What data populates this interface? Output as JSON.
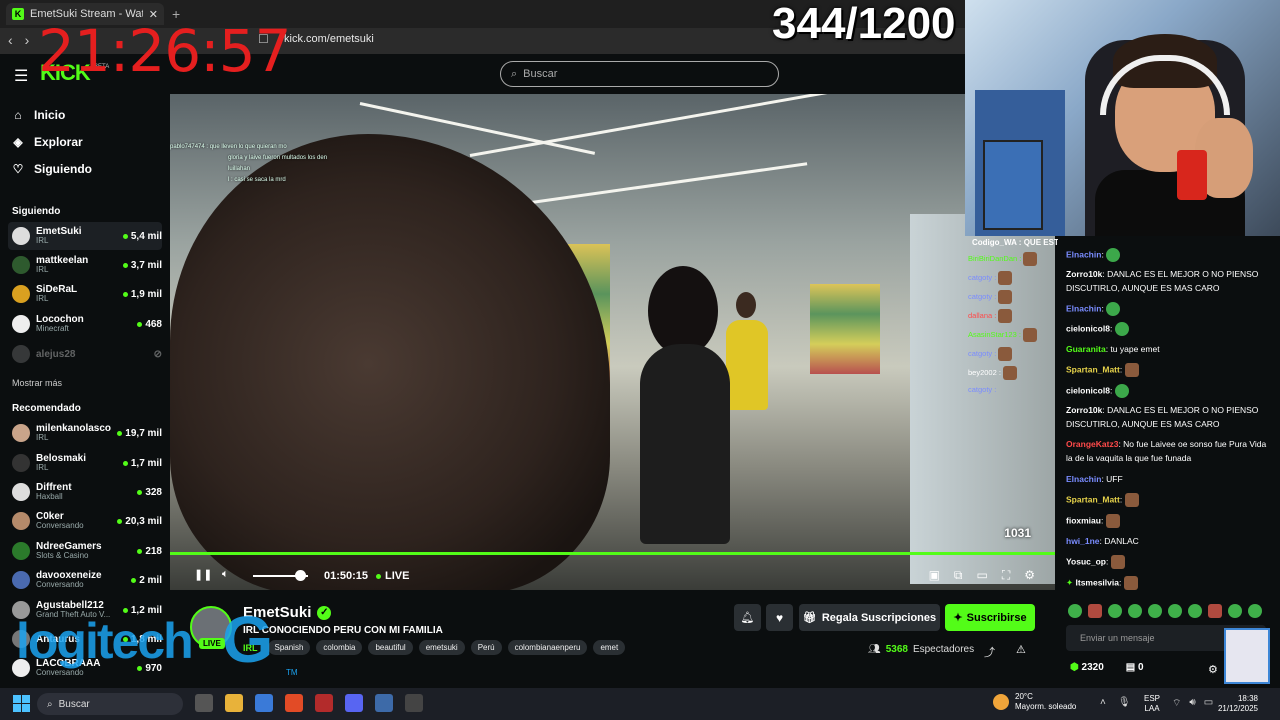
{
  "browser": {
    "tab_title": "EmetSuki Stream - Watch Liv",
    "tab_close": "✕",
    "new_tab": "+",
    "url": "kick.com/emetsuki"
  },
  "overlay": {
    "clock": "21:26:57",
    "counter": "344/1200",
    "logitech": "logitech",
    "logitech_g": "G",
    "logitech_tm": "TM"
  },
  "header": {
    "logo": "KICK",
    "beta": "BETA",
    "search_placeholder": "Buscar"
  },
  "sidebar": {
    "nav": [
      {
        "label": "Inicio",
        "icon": "home-icon"
      },
      {
        "label": "Explorar",
        "icon": "compass-icon"
      },
      {
        "label": "Siguiendo",
        "icon": "heart-icon"
      }
    ],
    "following_title": "Siguiendo",
    "following": [
      {
        "name": "EmetSuki",
        "category": "IRL",
        "viewers": "5,4 mil"
      },
      {
        "name": "mattkeelan",
        "category": "IRL",
        "viewers": "3,7 mil"
      },
      {
        "name": "SiDeRaL",
        "category": "IRL",
        "viewers": "1,9 mil"
      },
      {
        "name": "Locochon",
        "category": "Minecraft",
        "viewers": "468"
      },
      {
        "name": "alejus28",
        "category": "",
        "viewers": ""
      }
    ],
    "show_more": "Mostrar más",
    "recommended_title": "Recomendado",
    "recommended": [
      {
        "name": "milenkanolasco",
        "category": "IRL",
        "viewers": "19,7 mil"
      },
      {
        "name": "Belosmaki",
        "category": "IRL",
        "viewers": "1,7 mil"
      },
      {
        "name": "Diffrent",
        "category": "Haxball",
        "viewers": "328"
      },
      {
        "name": "C0ker",
        "category": "Conversando",
        "viewers": "20,3 mil"
      },
      {
        "name": "NdreeGamers",
        "category": "Slots & Casino",
        "viewers": "218"
      },
      {
        "name": "davooxeneize",
        "category": "Conversando",
        "viewers": "2 mil"
      },
      {
        "name": "Agustabell212",
        "category": "Grand Theft Auto V...",
        "viewers": "1,2 mil"
      },
      {
        "name": "Antaurus",
        "category": "",
        "viewers": "1,8 mil"
      },
      {
        "name": "LACOBRAAA",
        "category": "Conversando",
        "viewers": "970"
      }
    ]
  },
  "video": {
    "overlay_chat": [
      "pablo747474 : que lleven lo que quieran mo",
      "gloria y laive fueron multados los den",
      "luillahan",
      "l : casi se saca la mrd"
    ],
    "time": "01:50:15",
    "live": "LIVE",
    "volume": 0.85,
    "corner_num": "1031"
  },
  "stream": {
    "name": "EmetSuki",
    "live_badge": "LIVE",
    "title": "IRL CONOCIENDO PERU CON MI FAMILIA",
    "category": "IRL",
    "tags": [
      "Spanish",
      "colombia",
      "beautiful",
      "emetsuki",
      "Perú",
      "colombianaenperu",
      "emet"
    ],
    "gift_label": "Regala Suscripciones",
    "subscribe_label": "Suscribirse",
    "viewers_count": "5368",
    "viewers_label": "Espectadores"
  },
  "minichat": [
    {
      "user": "BiriBiriDanDan :",
      "color": "#53fc18"
    },
    {
      "user": "catgoty :",
      "color": "#7a8cff"
    },
    {
      "user": "catgoty :",
      "color": "#7a8cff"
    },
    {
      "user": "dallana :",
      "color": "#ff4a4a"
    },
    {
      "user": "AsasinStar123 :",
      "color": "#53fc18"
    },
    {
      "user": "catgoty :",
      "color": "#7a8cff"
    },
    {
      "user": "bey2002 :",
      "color": "#ffffff"
    },
    {
      "user": "catgoty :",
      "color": "#7a8cff"
    }
  ],
  "chat": {
    "pinned": "Codigo_WA : QUE ESTAS VIENDO SOBRINO",
    "messages": [
      {
        "user": "Elnachin",
        "text": "",
        "color": "#7a8cff",
        "emote": true
      },
      {
        "user": "Zorro10k",
        "text": "DANLAC ES EL MEJOR O NO PIENSO DISCUTIRLO, AUNQUE ES MAS CARO",
        "color": "#ffffff",
        "emote": false
      },
      {
        "user": "Elnachin",
        "text": "",
        "color": "#7a8cff",
        "emote": true
      },
      {
        "user": "cielonicol8",
        "text": "",
        "color": "#ffffff",
        "emote": true
      },
      {
        "user": "Guaranita",
        "text": "tu yape emet",
        "color": "#53fc18",
        "emote": false
      },
      {
        "user": "Spartan_Matt",
        "text": "",
        "color": "#e6d24a",
        "emote": true
      },
      {
        "user": "cielonicol8",
        "text": "",
        "color": "#ffffff",
        "emote": true
      },
      {
        "user": "Zorro10k",
        "text": "DANLAC ES EL MEJOR O NO PIENSO DISCUTIRLO, AUNQUE ES MAS CARO",
        "color": "#ffffff",
        "emote": false
      },
      {
        "user": "OrangeKatz3",
        "text": "No fue Laivee oe sonso fue Pura Vida la de la vaquita la que fue funada",
        "color": "#ff4a4a",
        "emote": false
      },
      {
        "user": "Elnachin",
        "text": "UFF",
        "color": "#7a8cff",
        "emote": false
      },
      {
        "user": "Spartan_Matt",
        "text": "",
        "color": "#e6d24a",
        "emote": true
      },
      {
        "user": "fioxmiau",
        "text": "",
        "color": "#ffffff",
        "emote": true
      },
      {
        "user": "hwi_1ne",
        "text": "DANLAC",
        "color": "#7a8cff",
        "emote": false
      },
      {
        "user": "Yosuc_op",
        "text": "",
        "color": "#ffffff",
        "emote": true
      },
      {
        "user": "Itsmesilvia",
        "text": "",
        "color": "#ffffff",
        "emote": true
      }
    ],
    "input_placeholder": "Enviar un mensaje",
    "points": "2320",
    "other_count": "0"
  },
  "taskbar": {
    "search": "Buscar",
    "temp": "20°C",
    "weather": "Mayorm. soleado",
    "lang1": "ESP",
    "lang2": "LAA",
    "time": "18:38",
    "date": "21/12/2025"
  }
}
